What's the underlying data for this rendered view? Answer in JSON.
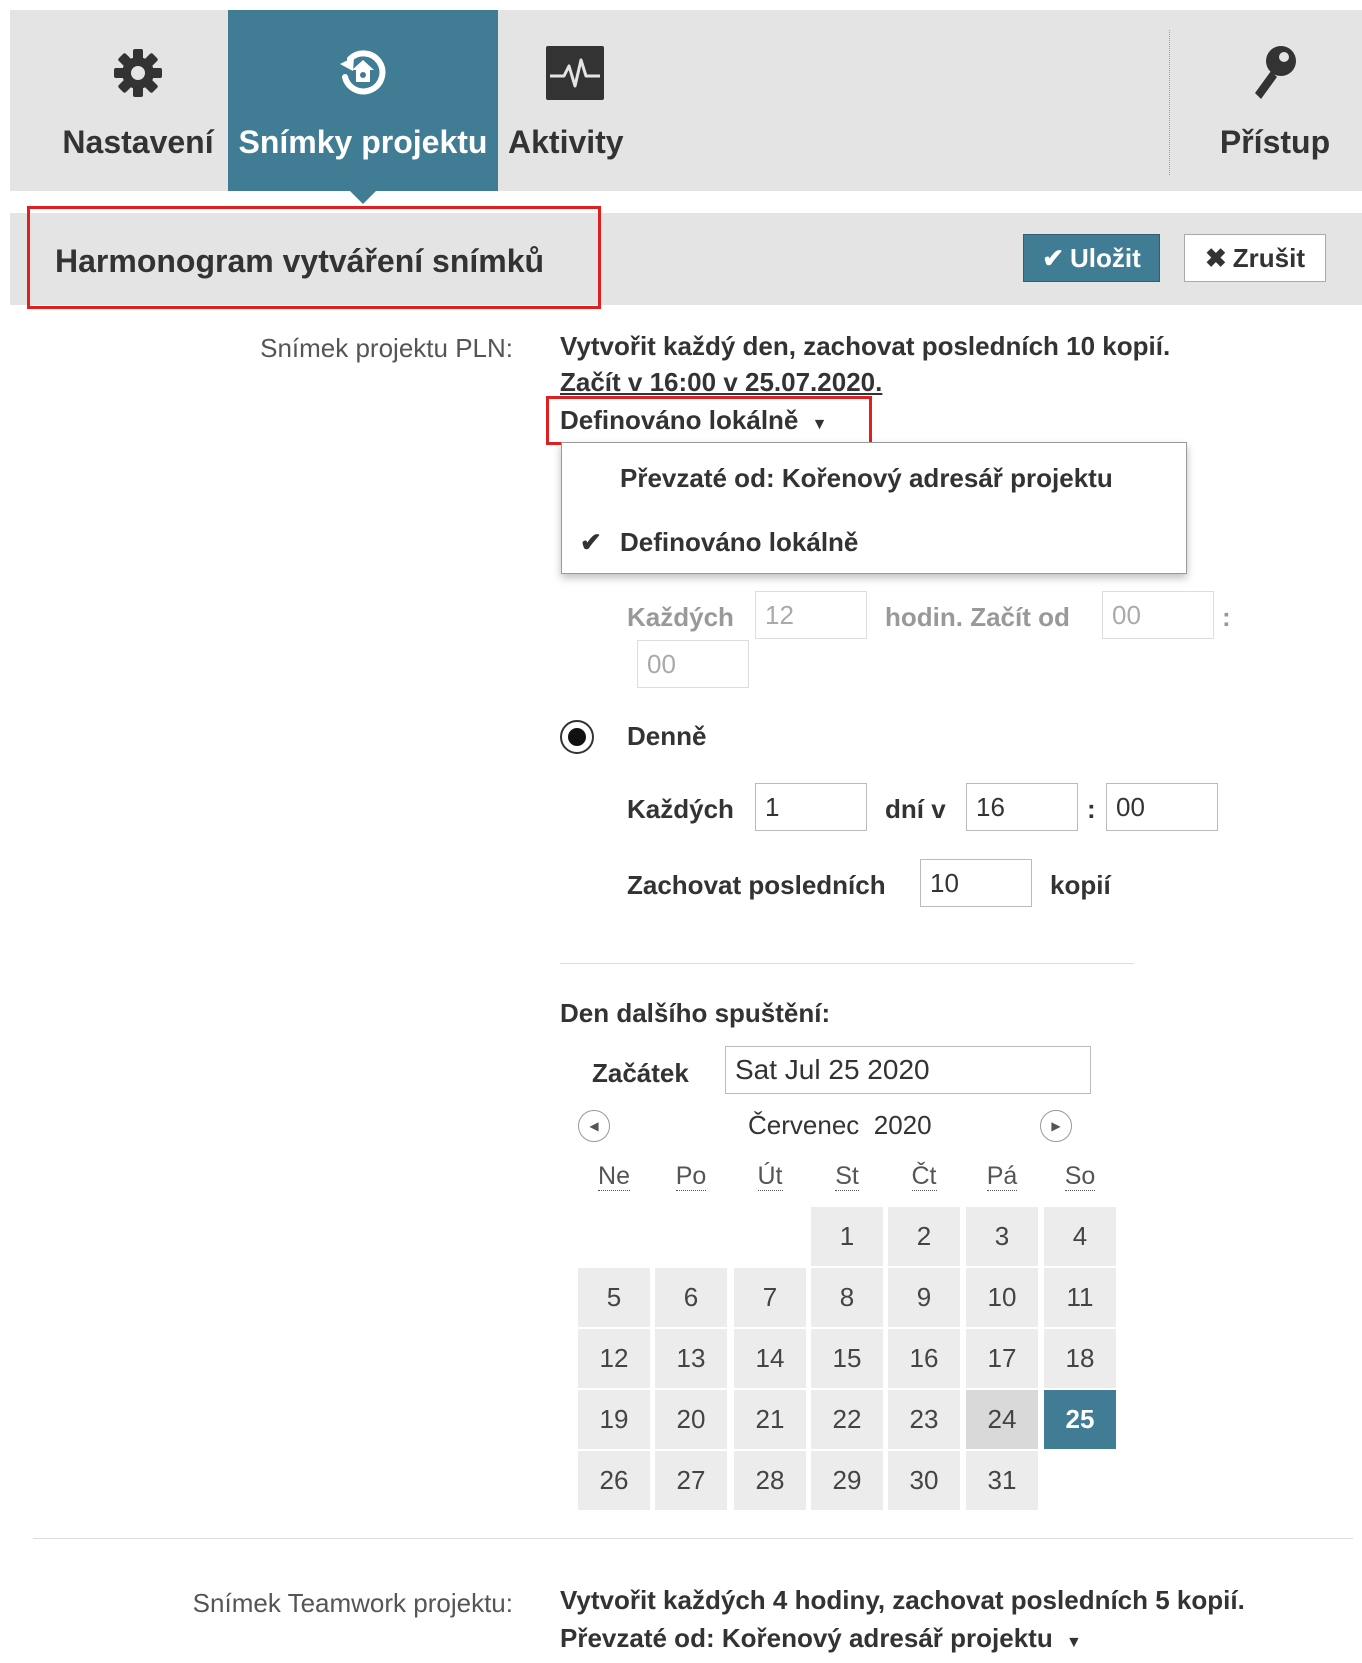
{
  "tabs": [
    {
      "label": "Nastavení",
      "icon": "gear-icon"
    },
    {
      "label": "Snímky projektu",
      "icon": "snapshot-restore-icon"
    },
    {
      "label": "Aktivity",
      "icon": "activity-pulse-icon"
    },
    {
      "label": "Přístup",
      "icon": "key-icon"
    }
  ],
  "section": {
    "title": "Harmonogram vytváření snímků"
  },
  "buttons": {
    "save": "Uložit",
    "cancel": "Zrušit"
  },
  "pln": {
    "label": "Snímek projektu PLN:",
    "summary_line1": "Vytvořit každý den, zachovat posledních 10 kopií.",
    "summary_line2": "Začít v 16:00 v 25.07.2020.",
    "dropdown_selected": "Definováno lokálně",
    "dropdown_options": [
      "Převzaté od: Kořenový adresář projektu",
      "Definováno lokálně"
    ]
  },
  "hourly": {
    "every_label": "Každých",
    "hours_value": "12",
    "hours_label": "hodin. Začít od",
    "start_hour": "00",
    "colon": ":",
    "start_minute": "00"
  },
  "daily": {
    "radio_label": "Denně",
    "every_label": "Každých",
    "days_value": "1",
    "days_label": "dní v",
    "hour": "16",
    "colon": ":",
    "minute": "00"
  },
  "retention": {
    "label": "Zachovat posledních",
    "value": "10",
    "suffix": "kopií"
  },
  "next_run": {
    "label": "Den dalšího spuštění:",
    "start_label": "Začátek",
    "start_value": "Sat Jul 25 2020",
    "month_title": "Červenec",
    "year": "2020",
    "weekdays": [
      "Ne",
      "Po",
      "Út",
      "St",
      "Čt",
      "Pá",
      "So"
    ],
    "days": [
      [
        "",
        "",
        "",
        "1",
        "2",
        "3",
        "4"
      ],
      [
        "5",
        "6",
        "7",
        "8",
        "9",
        "10",
        "11"
      ],
      [
        "12",
        "13",
        "14",
        "15",
        "16",
        "17",
        "18"
      ],
      [
        "19",
        "20",
        "21",
        "22",
        "23",
        "24",
        "25"
      ],
      [
        "26",
        "27",
        "28",
        "29",
        "30",
        "31",
        ""
      ]
    ],
    "today": "24",
    "selected": "25"
  },
  "teamwork": {
    "label": "Snímek Teamwork projektu:",
    "summary": "Vytvořit každých 4 hodiny, zachovat posledních 5 kopií.",
    "inherited": "Převzaté od: Kořenový adresář projektu"
  },
  "colors": {
    "accent": "#407d95",
    "highlight": "#e02020",
    "header_bg": "#e4e4e4"
  }
}
